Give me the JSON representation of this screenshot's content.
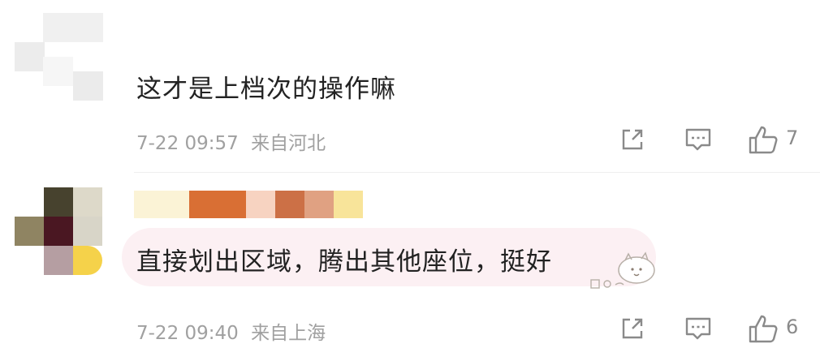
{
  "comments": [
    {
      "text": "这才是上档次的操作嘛",
      "time": "7-22 09:57",
      "location": "来自河北",
      "likes": "7",
      "actions": {
        "share": "share-icon",
        "comment": "comment-icon",
        "like": "thumbs-up-icon"
      }
    },
    {
      "text": "直接划出区域，腾出其他座位，挺好",
      "time": "7-22 09:40",
      "location": "来自上海",
      "likes": "6",
      "actions": {
        "share": "share-icon",
        "comment": "comment-icon",
        "like": "thumbs-up-icon"
      }
    }
  ],
  "colors": {
    "text": "#222222",
    "meta": "#a0a0a0",
    "icon": "#8a8a8a",
    "bubble": "#fcf0f3"
  }
}
